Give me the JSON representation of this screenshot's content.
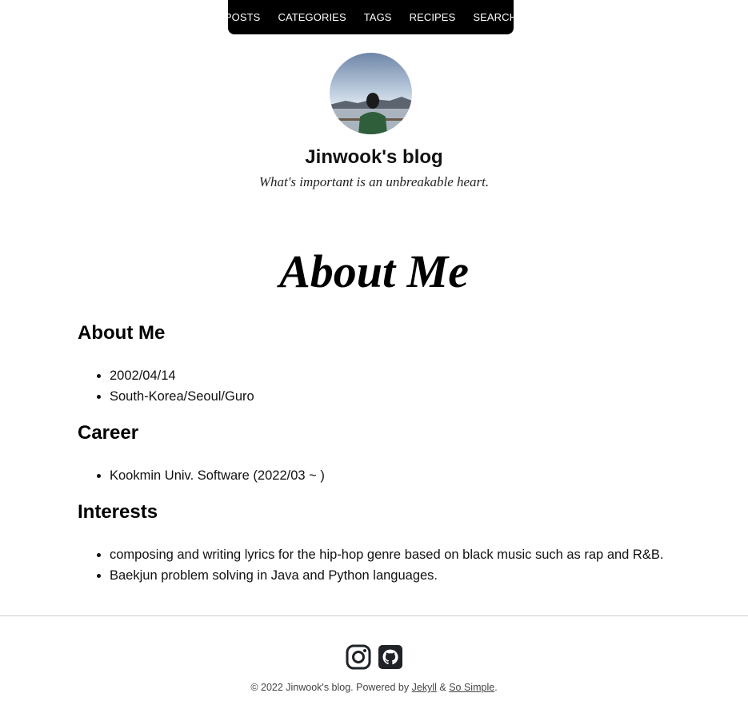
{
  "nav": {
    "items": [
      {
        "label": "POSTS"
      },
      {
        "label": "CATEGORIES"
      },
      {
        "label": "TAGS"
      },
      {
        "label": "RECIPES"
      },
      {
        "label": "SEARCH"
      }
    ]
  },
  "site": {
    "title": "Jinwook's blog",
    "description": "What's important is an unbreakable heart."
  },
  "page": {
    "title": "About Me",
    "sections": [
      {
        "heading": "About Me",
        "items": [
          "2002/04/14",
          "South-Korea/Seoul/Guro"
        ]
      },
      {
        "heading": "Career",
        "items": [
          "Kookmin Univ. Software (2022/03 ~ )"
        ]
      },
      {
        "heading": "Interests",
        "items": [
          "composing and writing lyrics for the hip-hop genre based on black music such as rap and R&B.",
          "Baekjun problem solving in Java and Python languages."
        ]
      }
    ]
  },
  "footer": {
    "social": [
      {
        "icon": "instagram-icon"
      },
      {
        "icon": "github-icon"
      }
    ],
    "copyright": "© 2022 Jinwook's blog. Powered by",
    "jekyll_label": "Jekyll",
    "amp": "&",
    "theme_label": "So Simple",
    "period": "."
  }
}
